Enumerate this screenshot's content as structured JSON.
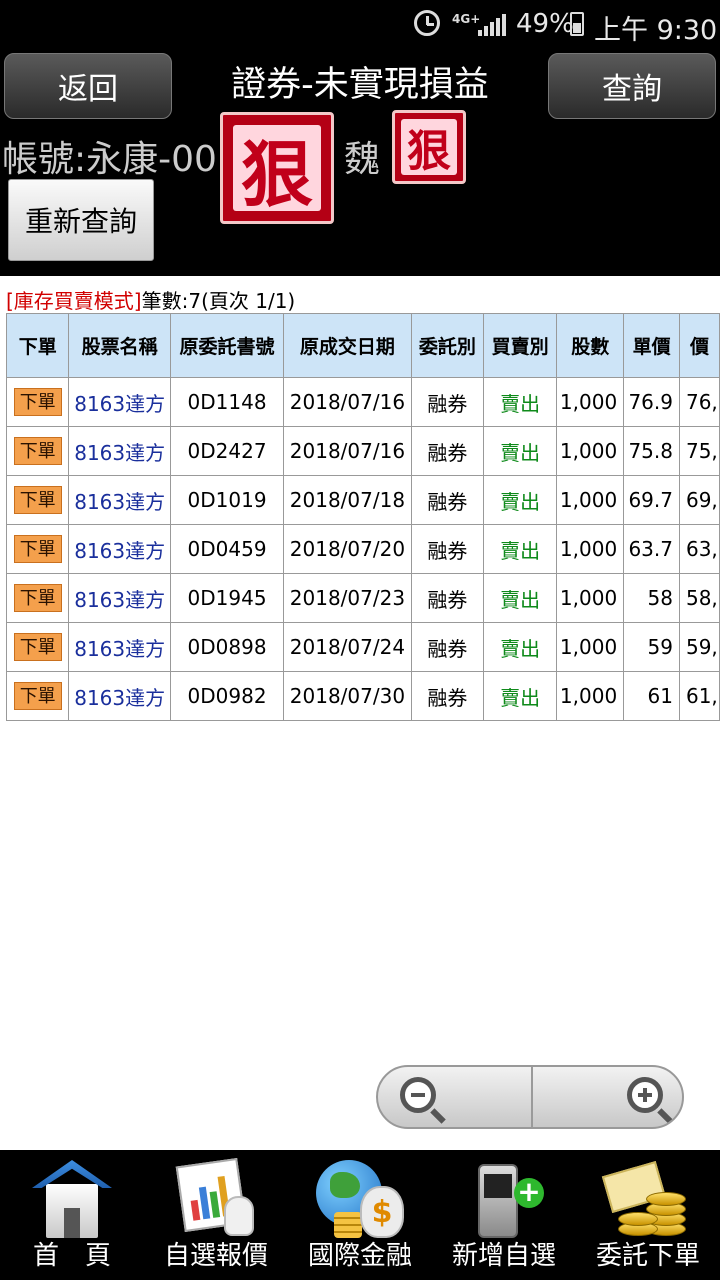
{
  "status_bar": {
    "network": "4G+",
    "battery": "49%",
    "time": "上午 9:30"
  },
  "header": {
    "back_label": "返回",
    "title": "證券-未實現損益",
    "query_label": "查詢",
    "account_label": "帳號:永康-00",
    "account_name": "魏",
    "stamp_char": "狠",
    "requery_label": "重新查詢"
  },
  "info": {
    "mode": "[庫存買賣模式]",
    "count_text": "筆數:7(頁次 1/1)"
  },
  "table": {
    "columns": [
      "下單",
      "股票名稱",
      "原委託書號",
      "原成交日期",
      "委託別",
      "買賣別",
      "股數",
      "單價",
      "價"
    ],
    "order_btn_label": "下單",
    "rows": [
      {
        "stock": "8163達方",
        "order_no": "0D1148",
        "date": "2018/07/16",
        "type": "融券",
        "side": "賣出",
        "shares": "1,000",
        "price": "76.9",
        "value": "76,"
      },
      {
        "stock": "8163達方",
        "order_no": "0D2427",
        "date": "2018/07/16",
        "type": "融券",
        "side": "賣出",
        "shares": "1,000",
        "price": "75.8",
        "value": "75,"
      },
      {
        "stock": "8163達方",
        "order_no": "0D1019",
        "date": "2018/07/18",
        "type": "融券",
        "side": "賣出",
        "shares": "1,000",
        "price": "69.7",
        "value": "69,"
      },
      {
        "stock": "8163達方",
        "order_no": "0D0459",
        "date": "2018/07/20",
        "type": "融券",
        "side": "賣出",
        "shares": "1,000",
        "price": "63.7",
        "value": "63,"
      },
      {
        "stock": "8163達方",
        "order_no": "0D1945",
        "date": "2018/07/23",
        "type": "融券",
        "side": "賣出",
        "shares": "1,000",
        "price": "58",
        "value": "58,"
      },
      {
        "stock": "8163達方",
        "order_no": "0D0898",
        "date": "2018/07/24",
        "type": "融券",
        "side": "賣出",
        "shares": "1,000",
        "price": "59",
        "value": "59,"
      },
      {
        "stock": "8163達方",
        "order_no": "0D0982",
        "date": "2018/07/30",
        "type": "融券",
        "side": "賣出",
        "shares": "1,000",
        "price": "61",
        "value": "61,"
      }
    ]
  },
  "zoom": {
    "out_icon": "zoom-out-icon",
    "in_icon": "zoom-in-icon"
  },
  "bottom_nav": [
    {
      "label": "首　頁",
      "icon": "home-icon"
    },
    {
      "label": "自選報價",
      "icon": "chart-report-icon"
    },
    {
      "label": "國際金融",
      "icon": "globe-money-icon"
    },
    {
      "label": "新增自選",
      "icon": "phone-add-icon"
    },
    {
      "label": "委託下單",
      "icon": "cash-coins-icon"
    }
  ],
  "colors": {
    "header_bg": "#000000",
    "table_header_bg": "#cde4f7",
    "stock_name": "#1a2f9c",
    "sell_text": "#0e8a1a",
    "mode_text": "#d10000",
    "order_button": "#f4a04c"
  }
}
